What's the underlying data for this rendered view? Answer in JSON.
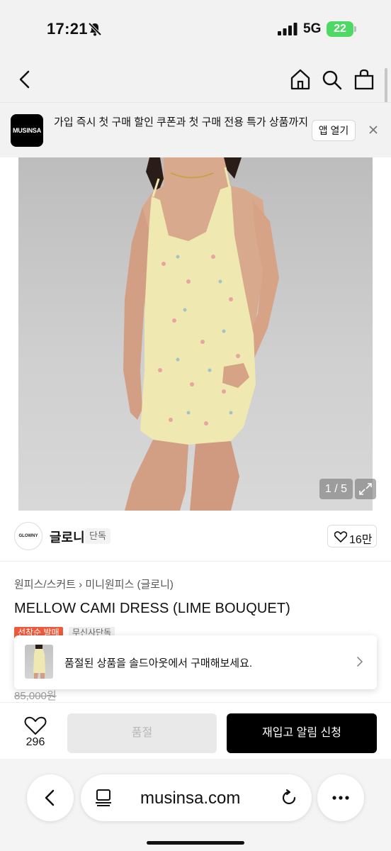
{
  "status_bar": {
    "time": "17:21",
    "network": "5G",
    "battery": "22"
  },
  "nav": {
    "icons": [
      "back-icon",
      "home-icon",
      "search-icon",
      "shopping-bag-icon"
    ]
  },
  "app_banner": {
    "logo_text": "MUSINSA",
    "message": "가입 즉시 첫 구매 할인 쿠폰과 첫 구매 전용 특가 상품까지",
    "open_label": "앱 열기"
  },
  "gallery": {
    "counter": "1 / 5"
  },
  "brand": {
    "logo_text": "GLOWNY",
    "name": "글로니",
    "badge": "단독",
    "like_count": "16만"
  },
  "product": {
    "breadcrumb_1": "원피스/스커트",
    "breadcrumb_2": "미니원피스 (글로니)",
    "title": "MELLOW CAMI DRESS (LIME BOUQUET)",
    "tag_sale": "선착순 발매",
    "tag_exclusive": "무신사단독",
    "original_price": "85,000원"
  },
  "soldout_card": {
    "message": "품절된 상품을 솔드아웃에서 구매해보세요."
  },
  "action_bar": {
    "like_total": "296",
    "soldout_label": "품절",
    "restock_label": "재입고 알림 신청"
  },
  "browser": {
    "url": "musinsa.com"
  },
  "colors": {
    "accent_red": "#ee5a3c",
    "primary_black": "#000000",
    "battery_green": "#4cd964",
    "dress_lime": "#efe8b0"
  }
}
